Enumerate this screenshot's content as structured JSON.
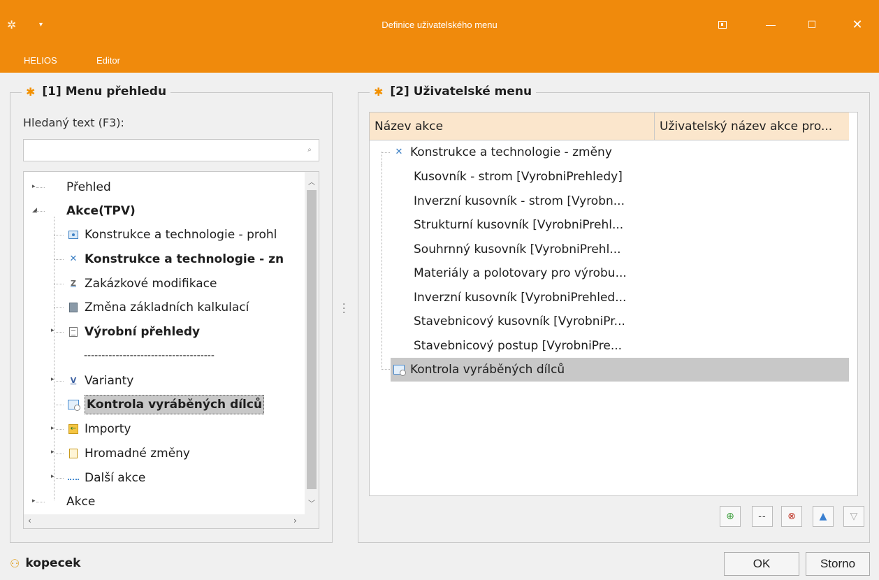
{
  "window": {
    "title": "Definice uživatelského menu",
    "menu": [
      "HELIOS",
      "Editor"
    ],
    "buttons": {
      "minimize": "—",
      "maximize": "☐",
      "close": "✕"
    }
  },
  "left_panel": {
    "title": "[1] Menu přehledu",
    "search_label": "Hledaný text (F3):",
    "search_value": "",
    "tree": [
      {
        "label": "Přehled",
        "bold": false,
        "level": 0,
        "expander": "▸",
        "icon": ""
      },
      {
        "label": "Akce(TPV)",
        "bold": true,
        "level": 0,
        "expander": "◢",
        "icon": ""
      },
      {
        "label": "Konstrukce a technologie - prohl",
        "bold": false,
        "level": 1,
        "icon": "view-icon"
      },
      {
        "label": "Konstrukce a technologie - zn",
        "bold": true,
        "level": 1,
        "icon": "tools-icon"
      },
      {
        "label": "Zakázkové modifikace",
        "bold": false,
        "level": 1,
        "icon": "z-icon"
      },
      {
        "label": "Změna základních kalkulací",
        "bold": false,
        "level": 1,
        "icon": "calculator-icon"
      },
      {
        "label": "Výrobní přehledy",
        "bold": true,
        "level": 1,
        "expander": "▸",
        "icon": "document-icon"
      },
      {
        "label": "-------------------------------------",
        "bold": false,
        "level": 1,
        "icon": ""
      },
      {
        "label": "Varianty",
        "bold": false,
        "level": 1,
        "expander": "▸",
        "icon": "variant-icon"
      },
      {
        "label": "Kontrola vyráběných dílců",
        "bold": true,
        "level": 1,
        "icon": "inspection-icon",
        "selected": true
      },
      {
        "label": "Importy",
        "bold": false,
        "level": 1,
        "expander": "▸",
        "icon": "import-icon"
      },
      {
        "label": "Hromadné změny",
        "bold": false,
        "level": 1,
        "expander": "▸",
        "icon": "bulk-change-icon"
      },
      {
        "label": "Další akce",
        "bold": false,
        "level": 1,
        "expander": "▸",
        "icon": "more-actions-icon"
      },
      {
        "label": "Akce",
        "bold": false,
        "level": 0,
        "expander": "▸",
        "icon": ""
      }
    ]
  },
  "right_panel": {
    "title": "[2] Uživatelské menu",
    "columns": [
      "Název akce",
      "Uživatelský název akce pro..."
    ],
    "rows": [
      {
        "label": "Konstrukce a technologie - změny",
        "level": 0,
        "icon": "tools-icon"
      },
      {
        "label": "Kusovník - strom [VyrobniPrehledy]",
        "level": 1
      },
      {
        "label": "Inverzní kusovník - strom [Vyrobn...",
        "level": 1
      },
      {
        "label": "Strukturní kusovník [VyrobniPrehl...",
        "level": 1
      },
      {
        "label": "Souhrnný kusovník [VyrobniPrehl...",
        "level": 1
      },
      {
        "label": "Materiály a polotovary pro výrobu...",
        "level": 1
      },
      {
        "label": "Inverzní kusovník [VyrobniPrehled...",
        "level": 1
      },
      {
        "label": "Stavebnicový kusovník [VyrobniPr...",
        "level": 1
      },
      {
        "label": "Stavebnicový postup [VyrobniPre...",
        "level": 1
      },
      {
        "label": "Kontrola vyráběných dílců",
        "level": 0,
        "icon": "inspection-icon",
        "selected": true
      }
    ],
    "toolbar": {
      "separator_label": "--"
    }
  },
  "footer": {
    "user": "kopecek",
    "ok_label": "OK",
    "cancel_label": "Storno"
  },
  "colors": {
    "accent": "#f08a0c",
    "header": "#fbe6cc",
    "selection": "#c8c8c8"
  }
}
